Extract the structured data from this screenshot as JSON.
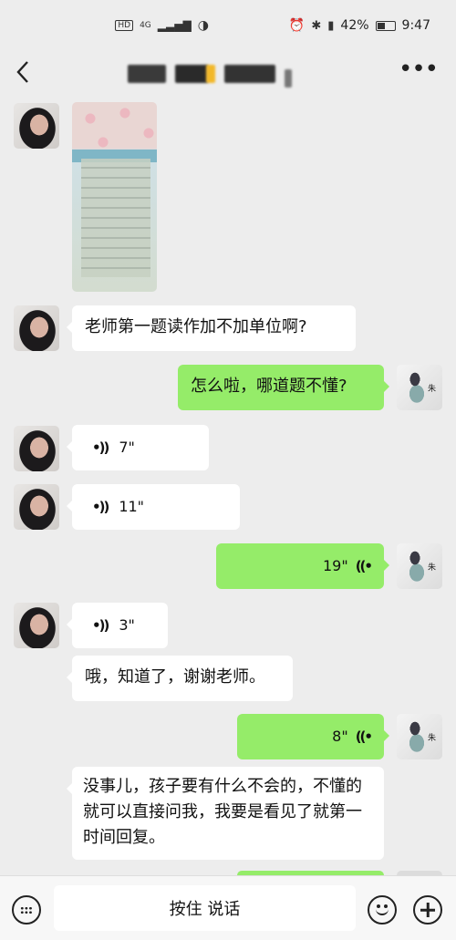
{
  "status_bar": {
    "network_badge": "HD",
    "network_type": "4G",
    "battery_percent": "42%",
    "time": "9:47",
    "battery_level": 0.42
  },
  "nav": {
    "back_icon": "chevron-left-icon",
    "more_icon": "more-dots-icon"
  },
  "messages": {
    "q1": "老师第一题读作加不加单位啊?",
    "r1": "怎么啦，哪道题不懂?",
    "v1": "7\"",
    "v2": "11\"",
    "v3": "19\"",
    "v4": "3\"",
    "t1": "哦，知道了，谢谢老师。",
    "v5": "8\"",
    "r2": "没事儿，孩子要有什么不会的，不懂的就可以直接问我，我要是看见了就第一时间回复。"
  },
  "avatars": {
    "right_char": "朱"
  },
  "input_bar": {
    "talk_label": "按住 说话"
  },
  "colors": {
    "background": "#ededed",
    "bubble_self": "#95ec69",
    "bubble_other": "#ffffff"
  }
}
